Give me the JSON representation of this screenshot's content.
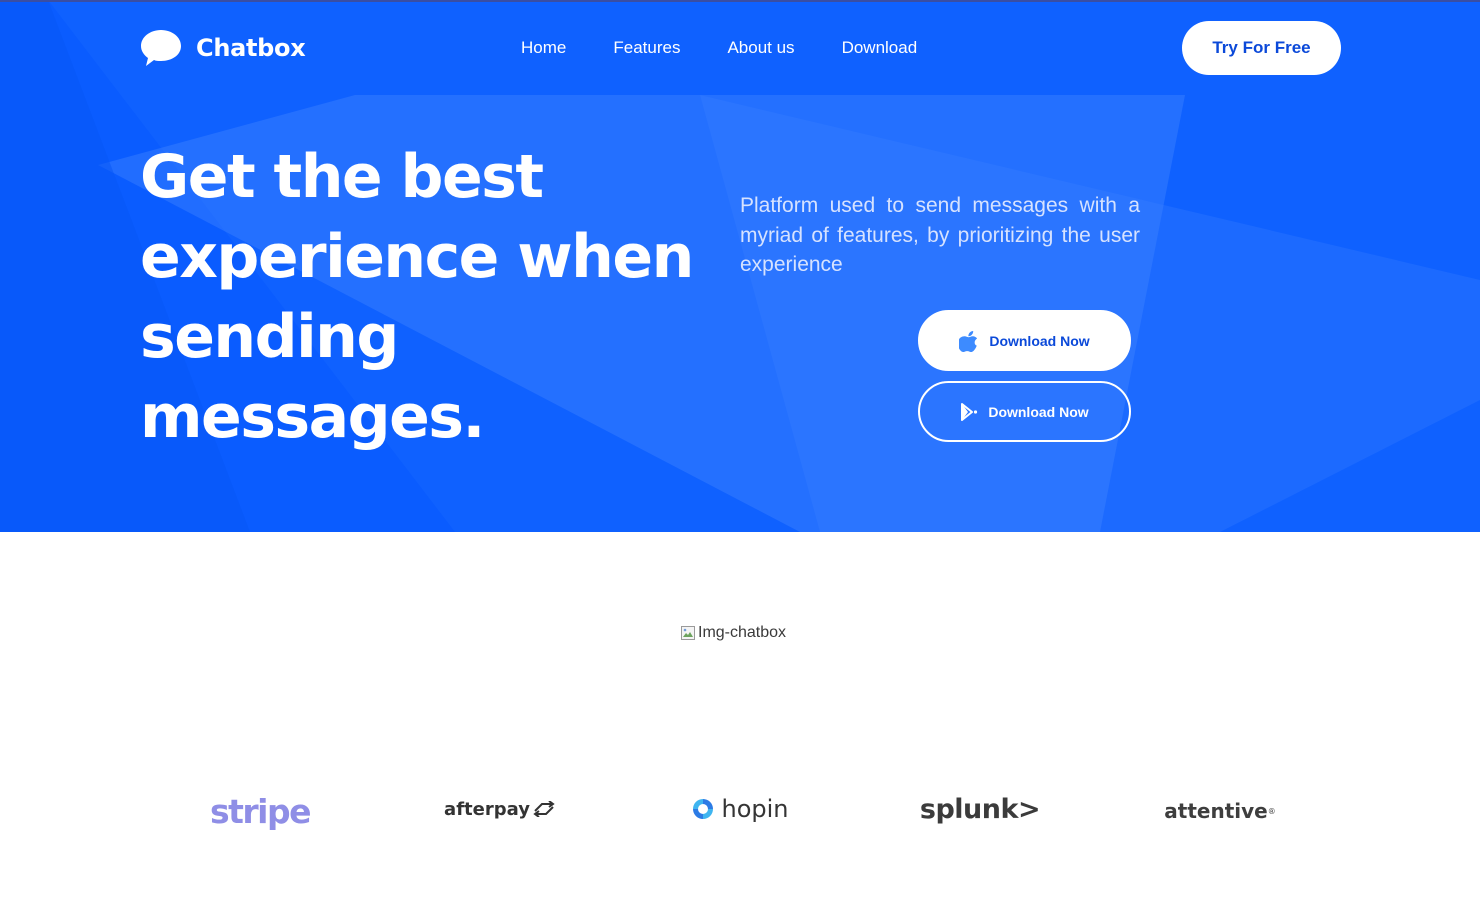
{
  "header": {
    "logo_text": "Chatbox",
    "nav": [
      {
        "label": "Home"
      },
      {
        "label": "Features"
      },
      {
        "label": "About us"
      },
      {
        "label": "Download"
      }
    ],
    "cta_label": "Try For Free"
  },
  "hero": {
    "title": "Get the best experience when sending messages.",
    "description": "Platform used to send messages with a myriad of features, by prioritizing the user experience",
    "download_apple_label": "Download Now",
    "download_play_label": "Download Now",
    "background_color": "#0a5cff"
  },
  "main": {
    "image_alt": "Img-chatbox"
  },
  "partners": [
    {
      "name": "stripe"
    },
    {
      "name": "afterpay"
    },
    {
      "name": "hopin"
    },
    {
      "name": "splunk>"
    },
    {
      "name": "attentive",
      "mark": "®"
    }
  ]
}
